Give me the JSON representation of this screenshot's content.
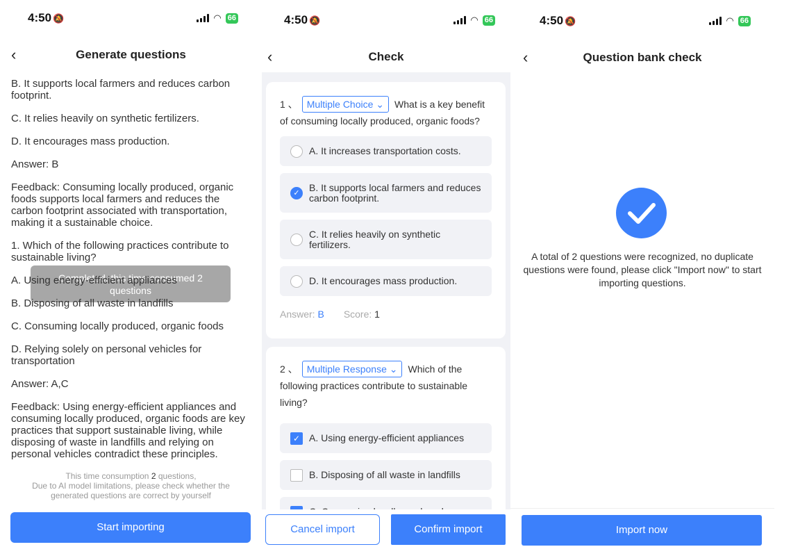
{
  "status": {
    "time": "4:50",
    "battery": "66"
  },
  "screen1": {
    "title": "Generate questions",
    "lines": [
      "B. It supports local farmers and reduces carbon footprint.",
      "C. It relies heavily on synthetic fertilizers.",
      "D. It encourages mass production.",
      "Answer: B",
      "Feedback: Consuming locally produced, organic foods supports local farmers and reduces the carbon footprint associated with transportation, making it a sustainable choice.",
      "1. Which of the following practices contribute to sustainable living?",
      "A. Using energy-efficient appliances",
      "B. Disposing of all waste in landfills",
      "C. Consuming locally produced, organic foods",
      "D. Relying solely on personal vehicles for transportation",
      "Answer: A,C",
      "Feedback: Using energy-efficient appliances and consuming locally produced, organic foods are key practices that support sustainable living, while disposing of waste in landfills and relying on personal vehicles contradict these principles."
    ],
    "toast": "Completed, this time consumed 2 questions",
    "note_prefix": "This time consumption ",
    "note_count": "2",
    "note_suffix": " questions,",
    "note_line2": "Due to AI model limitations, please check whether the generated questions are correct by yourself",
    "start_button": "Start importing"
  },
  "screen2": {
    "title": "Check",
    "questions": [
      {
        "num": "1 、",
        "type": "Multiple Choice",
        "text": "What is a key benefit of consuming locally produced, organic foods?",
        "options": [
          "A. It increases transportation costs.",
          "B. It supports local farmers and reduces carbon footprint.",
          "C. It relies heavily on synthetic fertilizers.",
          "D. It encourages mass production."
        ],
        "answer_label": "Answer: ",
        "answer": "B",
        "score_label": "Score: ",
        "score": "1"
      },
      {
        "num": "2 、",
        "type": "Multiple Response",
        "text": "Which of the following practices contribute to sustainable living?",
        "options": [
          "A. Using energy-efficient appliances",
          "B. Disposing of all waste in landfills",
          "C. Consuming locally produced,"
        ]
      }
    ],
    "cancel_button": "Cancel import",
    "confirm_button": "Confirm import"
  },
  "screen3": {
    "title": "Question bank check",
    "message": "A total of 2 questions were recognized, no duplicate questions were found, please click \"Import now\" to start importing questions.",
    "import_button": "Import now"
  },
  "colors": {
    "accent": "#3c80fb",
    "battery": "#34c759"
  }
}
